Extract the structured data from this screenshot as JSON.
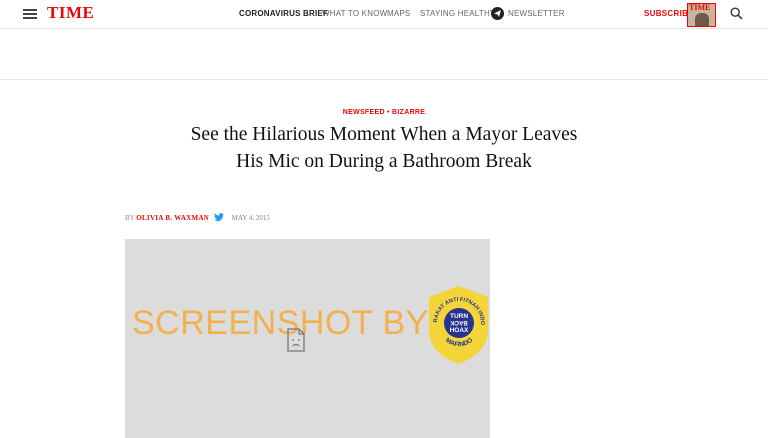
{
  "header": {
    "logo": "TIME",
    "nav": [
      {
        "label": "CORONAVIRUS BRIEF"
      },
      {
        "label": "WHAT TO KNOW"
      },
      {
        "label": "MAPS"
      },
      {
        "label": "STAYING HEALTHY"
      },
      {
        "label": "NEWSLETTER"
      }
    ],
    "subscribe_label": "SUBSCRIBE",
    "cover_title": "TIME"
  },
  "article": {
    "kicker": "NEWSFEED • BIZARRE",
    "headline_line1": "See the Hilarious Moment When a Mayor Leaves",
    "headline_line2": "His Mic on During a Bathroom Break",
    "byline_prefix": "BY",
    "author": "OLIVIA B. WAXMAN",
    "date": "MAY 4, 2015"
  },
  "media": {
    "watermark": "SCREENSHOT BY",
    "badge_top": "MASYARAKAT ANTI FITNAH INDONESIA",
    "badge_center_1": "TURN",
    "badge_center_2": "BACK",
    "badge_center_3": "HOAX",
    "badge_bottom": "MAFINDO"
  },
  "colors": {
    "brand_red": "#e90606",
    "watermark_orange": "#f2b04f",
    "badge_yellow": "#f3d539",
    "badge_blue": "#27338f"
  }
}
